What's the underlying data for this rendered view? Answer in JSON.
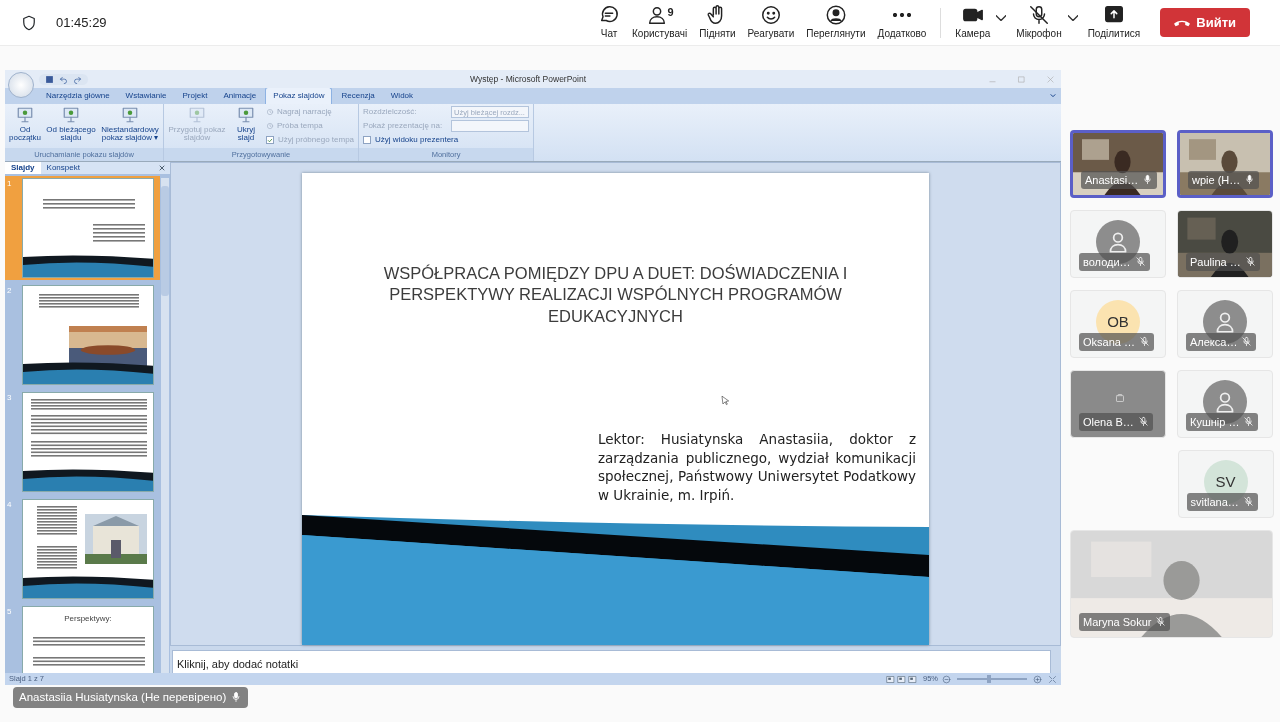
{
  "top_bar": {
    "time": "01:45:29",
    "actions": [
      {
        "label": "Чат"
      },
      {
        "label": "Користувачі",
        "count": "9"
      },
      {
        "label": "Підняти"
      },
      {
        "label": "Реагувати"
      },
      {
        "label": "Переглянути"
      },
      {
        "label": "Додатково"
      }
    ],
    "devices": [
      {
        "label": "Камера",
        "dropdown": true
      },
      {
        "label": "Мікрофон",
        "dropdown": true
      },
      {
        "label": "Поділитися",
        "dropdown": false
      }
    ],
    "leave_button": "Вийти"
  },
  "shared_screen": {
    "window_title": "Występ - Microsoft PowerPoint",
    "ribbon_tabs": [
      {
        "label": "Narzędzia główne",
        "selected": false
      },
      {
        "label": "Wstawianie",
        "selected": false
      },
      {
        "label": "Projekt",
        "selected": false
      },
      {
        "label": "Animacje",
        "selected": false
      },
      {
        "label": "Pokaz slajdów",
        "selected": true
      },
      {
        "label": "Recenzja",
        "selected": false
      },
      {
        "label": "Widok",
        "selected": false
      }
    ],
    "groups": [
      {
        "label": "Uruchamianie pokazu slajdów",
        "items": [
          {
            "kind": "large",
            "label": "Od początku",
            "disabled": false
          },
          {
            "kind": "large",
            "label": "Od bieżącego slajdu",
            "disabled": false
          },
          {
            "kind": "large",
            "label": "Niestandardowy pokaz slajdów ▾",
            "disabled": false
          }
        ]
      },
      {
        "label": "Przygotowywanie",
        "items": [
          {
            "kind": "large",
            "label": "Przygotuj pokaz slajdów",
            "disabled": true
          },
          {
            "kind": "large",
            "label": "Ukryj slajd",
            "disabled": false
          },
          {
            "kind": "small",
            "label": "Nagraj narrację",
            "disabled": true
          },
          {
            "kind": "small",
            "label": "Próba tempa",
            "disabled": true
          },
          {
            "kind": "check",
            "label": "Użyj próbnego tempa",
            "disabled": true,
            "checked": true
          }
        ]
      },
      {
        "label": "Monitory",
        "items": [
          {
            "kind": "select",
            "label": "Rozdzielczość:",
            "disabled": true,
            "value": "Użyj bieżącej rozdz..."
          },
          {
            "kind": "select",
            "label": "Pokaż prezentację na:",
            "disabled": true,
            "value": ""
          },
          {
            "kind": "check",
            "label": "Użyj widoku prezentera",
            "disabled": false,
            "checked": false
          }
        ]
      }
    ],
    "panel_tabs": [
      {
        "label": "Slajdy",
        "selected": true
      },
      {
        "label": "Konspekt",
        "selected": false
      }
    ],
    "thumbnails": [
      {
        "number": "1",
        "selected": true,
        "kind": "title"
      },
      {
        "number": "2",
        "selected": false
      },
      {
        "number": "3",
        "selected": false,
        "kind": "text"
      },
      {
        "number": "4",
        "selected": false,
        "kind": "photo-side"
      },
      {
        "number": "5",
        "selected": false,
        "kind": "heading",
        "heading": "Perspektywy:"
      }
    ],
    "slide": {
      "title": "WSPÓŁPRACA POMIĘDZY DPU A DUET: DOŚWIADCZENIA I PERSPEKTYWY REALIZACJI WSPÓLNYCH PROGRAMÓW EDUKACYJNYCH",
      "body": "Lektor: Husiatynska Anastasiia, doktor z zarządzania publicznego, wydział komunikacji społecznej, Państwowy Uniwersytet Podatkowy w Ukrainie, m. Irpiń."
    },
    "notes_placeholder": "Kliknij, aby dodać notatki",
    "status": "Slajd 1 z 7",
    "zoom": "95%",
    "zoom_slider": {
      "level": 0.45
    },
    "presenter_label": "Anastasiia Husiatynska (Не перевірено)"
  },
  "participants": [
    {
      "name": "Anastasi…",
      "kind": "video",
      "speaking": true,
      "muted": false
    },
    {
      "name": "wpie (H…",
      "kind": "video",
      "speaking": true,
      "muted": false
    },
    {
      "name": "володи…",
      "kind": "avatar",
      "speaking": false,
      "muted": true
    },
    {
      "name": "Paulina …",
      "kind": "video",
      "speaking": false,
      "muted": true
    },
    {
      "name": "Oksana …",
      "kind": "initials",
      "initials": "OB",
      "color": "#fbe3b0",
      "speaking": false,
      "muted": true
    },
    {
      "name": "Алекса…",
      "kind": "avatar",
      "speaking": false,
      "muted": true
    },
    {
      "name": "Olena B…",
      "kind": "off",
      "speaking": false,
      "muted": true
    },
    {
      "name": "Кушнір …",
      "kind": "avatar",
      "speaking": false,
      "muted": true
    },
    {
      "name": "svitlana…",
      "kind": "initials",
      "initials": "SV",
      "color": "#d3e4d9",
      "speaking": false,
      "muted": true
    },
    {
      "name": "Maryna Sokur",
      "kind": "video",
      "speaking": false,
      "muted": true
    }
  ]
}
